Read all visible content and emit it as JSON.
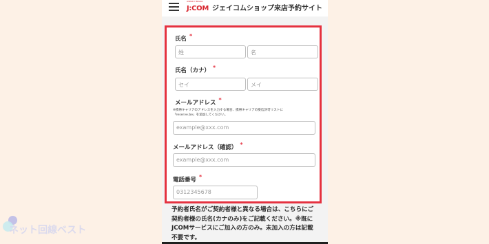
{
  "header": {
    "logo_tagline": "WHERE IT BEGINS",
    "logo_text": "J:COM",
    "title": "ジェイコムショップ来店予約サイト"
  },
  "form": {
    "name": {
      "label": "氏名",
      "required_mark": "*",
      "last_placeholder": "姓",
      "first_placeholder": "名"
    },
    "kana": {
      "label": "氏名（カナ）",
      "required_mark": "*",
      "last_placeholder": "セイ",
      "first_placeholder": "メイ"
    },
    "email": {
      "label": "メールアドレス",
      "required_mark": "*",
      "note_line1": "※携帯キャリアのアドレスを入力する場合、携帯キャリアの受信許可リストに",
      "note_line2": "「reserve.be」を追加してください。",
      "placeholder": "example@xxx.com"
    },
    "email_confirm": {
      "label": "メールアドレス（確認）",
      "required_mark": "*",
      "placeholder": "example@xxx.com"
    },
    "phone": {
      "label": "電話番号",
      "required_mark": "*",
      "placeholder": "0312345678"
    }
  },
  "notice": {
    "line1": "予約者氏名がご契約者様と異なる場合は、こちらにご",
    "line2": "契約者様の氏名(カナのみ)をご記載ください。※既に",
    "line3": "JCOMサービスにご加入の方のみ。未加入の方は記載",
    "line4": "不要です。"
  },
  "watermark": {
    "text": "ネット回線ベスト"
  },
  "colors": {
    "highlight_border": "#e53240",
    "required": "#e53240",
    "brand": "#d8262e",
    "page_background": "#fdf1e6"
  }
}
